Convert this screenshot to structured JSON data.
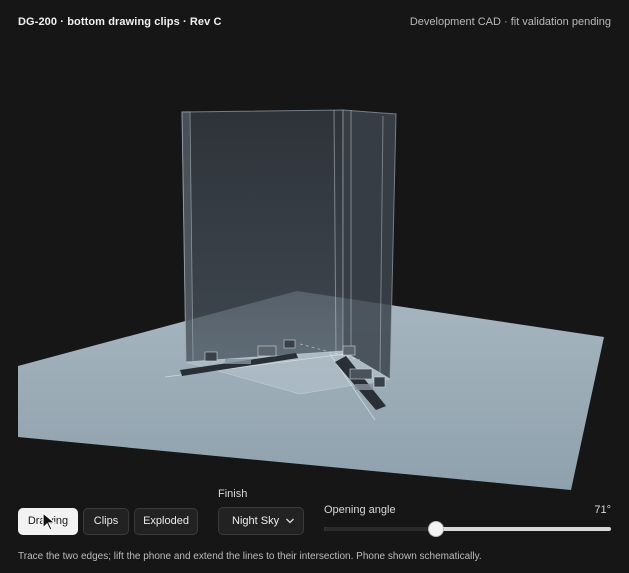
{
  "header": {
    "title": "DG-200 · bottom drawing clips · Rev C",
    "status": "Development CAD · fit validation pending"
  },
  "toolbar": {
    "buttons": [
      {
        "label": "Drawing",
        "active": true
      },
      {
        "label": "Clips",
        "active": false
      },
      {
        "label": "Exploded",
        "active": false
      }
    ]
  },
  "finish": {
    "label": "Finish",
    "selected": "Night Sky"
  },
  "opening_angle": {
    "label": "Opening angle",
    "value_text": "71°",
    "fraction": 0.39
  },
  "footer": {
    "note": "Trace the two edges; lift the phone and extend the lines to their intersection. Phone shown schematically."
  },
  "colors": {
    "background": "#161616",
    "plane": "#9aacb8",
    "phone": "#3a4048"
  }
}
